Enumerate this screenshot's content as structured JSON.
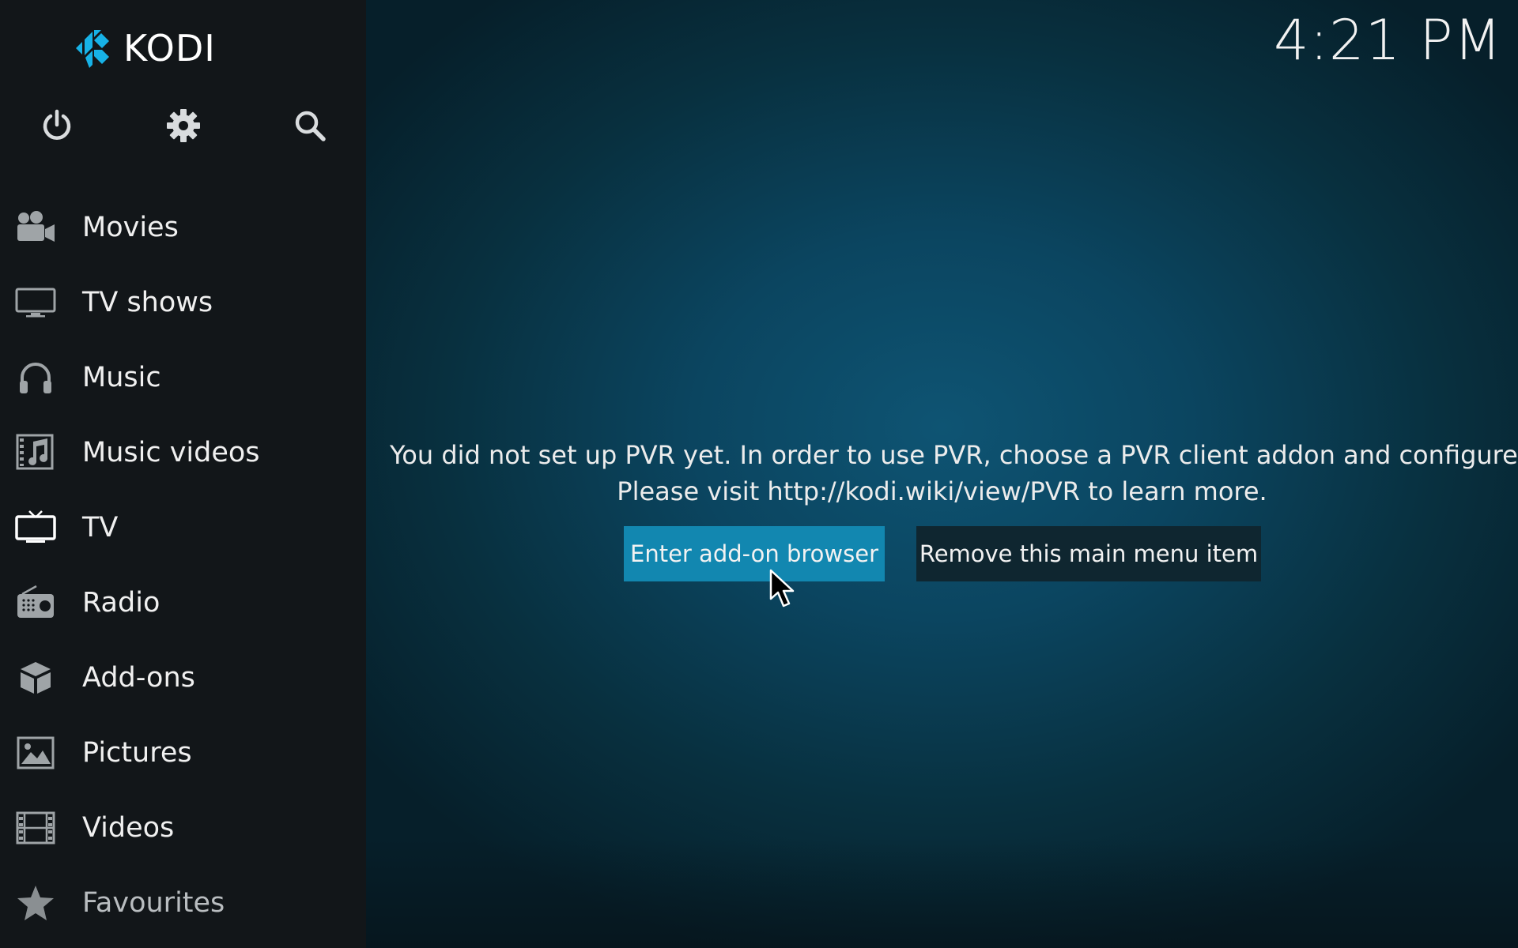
{
  "app": {
    "logo_text": "KODI",
    "clock": "4:21 PM"
  },
  "toolbar": {
    "power_icon": "power-icon",
    "settings_icon": "gear-icon",
    "search_icon": "search-icon"
  },
  "sidebar": {
    "items": [
      {
        "label": "Movies",
        "icon": "movie-camera-icon"
      },
      {
        "label": "TV shows",
        "icon": "monitor-icon"
      },
      {
        "label": "Music",
        "icon": "headphones-icon"
      },
      {
        "label": "Music videos",
        "icon": "music-video-icon"
      },
      {
        "label": "TV",
        "icon": "tv-icon"
      },
      {
        "label": "Radio",
        "icon": "radio-icon"
      },
      {
        "label": "Add-ons",
        "icon": "addon-box-icon"
      },
      {
        "label": "Pictures",
        "icon": "pictures-icon"
      },
      {
        "label": "Videos",
        "icon": "film-strip-icon"
      },
      {
        "label": "Favourites",
        "icon": "star-icon"
      }
    ]
  },
  "main": {
    "message_line1": "You did not set up PVR yet. In order to use PVR, choose a PVR client addon and configure it.",
    "message_line2": "Please visit http://kodi.wiki/view/PVR to learn more.",
    "enter_button": "Enter add-on browser",
    "remove_button": "Remove this main menu item"
  },
  "colors": {
    "sidebar_bg": "#121619",
    "main_bg": "#0b4560",
    "primary_button": "#1287b0",
    "secondary_button": "#0f2630",
    "logo_blue": "#17b2e7"
  }
}
